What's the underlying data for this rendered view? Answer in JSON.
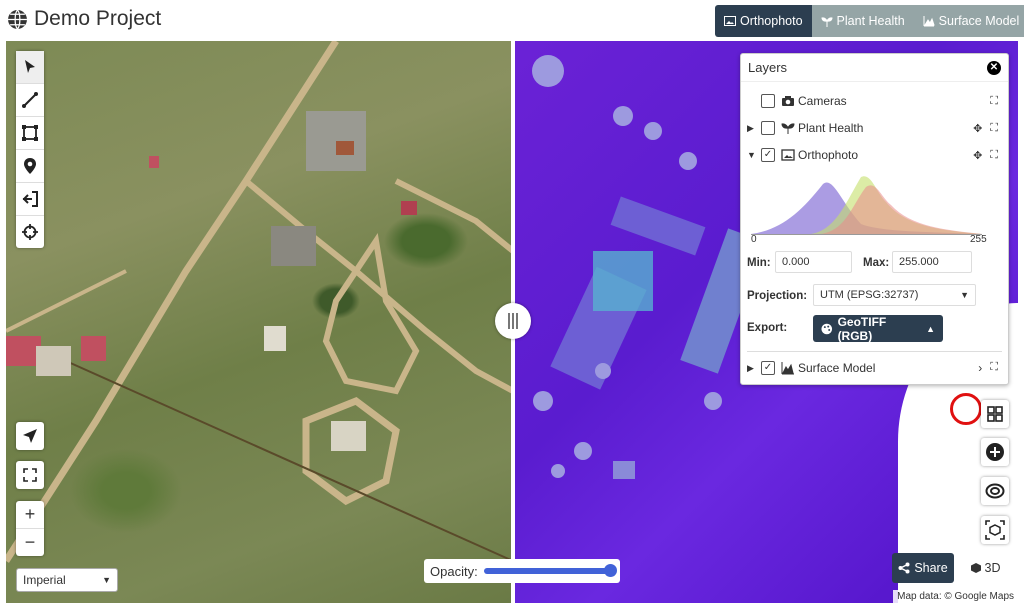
{
  "header": {
    "title": "Demo Project",
    "tabs": [
      {
        "label": "Orthophoto",
        "active": true,
        "icon": "image-icon"
      },
      {
        "label": "Plant Health",
        "active": false,
        "icon": "plant-icon"
      },
      {
        "label": "Surface Model",
        "active": false,
        "icon": "chart-area-icon"
      }
    ]
  },
  "toolbar": {
    "tools": [
      "select-pointer-icon",
      "measure-line-icon",
      "measure-area-icon",
      "point-marker-icon",
      "import-icon",
      "crosshair-icon"
    ]
  },
  "units": {
    "selected": "Imperial"
  },
  "opacity": {
    "label": "Opacity:",
    "value": 1.0
  },
  "layers_panel": {
    "title": "Layers",
    "layers": [
      {
        "label": "Cameras",
        "checked": false,
        "expandable": false
      },
      {
        "label": "Plant Health",
        "checked": false,
        "expandable": true
      },
      {
        "label": "Orthophoto",
        "checked": true,
        "expandable": true,
        "expanded": true
      },
      {
        "label": "Surface Model",
        "checked": true,
        "expandable": true
      }
    ],
    "histogram": {
      "min_label": "0",
      "max_label": "255"
    },
    "min_label": "Min:",
    "min_value": "0.000",
    "max_label": "Max:",
    "max_value": "255.000",
    "projection_label": "Projection:",
    "projection_value": "UTM (EPSG:32737)",
    "export_label": "Export:",
    "export_value": "GeoTIFF (RGB)"
  },
  "buttons": {
    "share": "Share",
    "view3d": "3D"
  },
  "attribution": "Map data: © Google Maps",
  "colors": {
    "dark": "#2c3e50",
    "tab_inactive": "#95a5a6",
    "surface_purple": "#5a1ccf",
    "highlight_red": "#e01010"
  }
}
